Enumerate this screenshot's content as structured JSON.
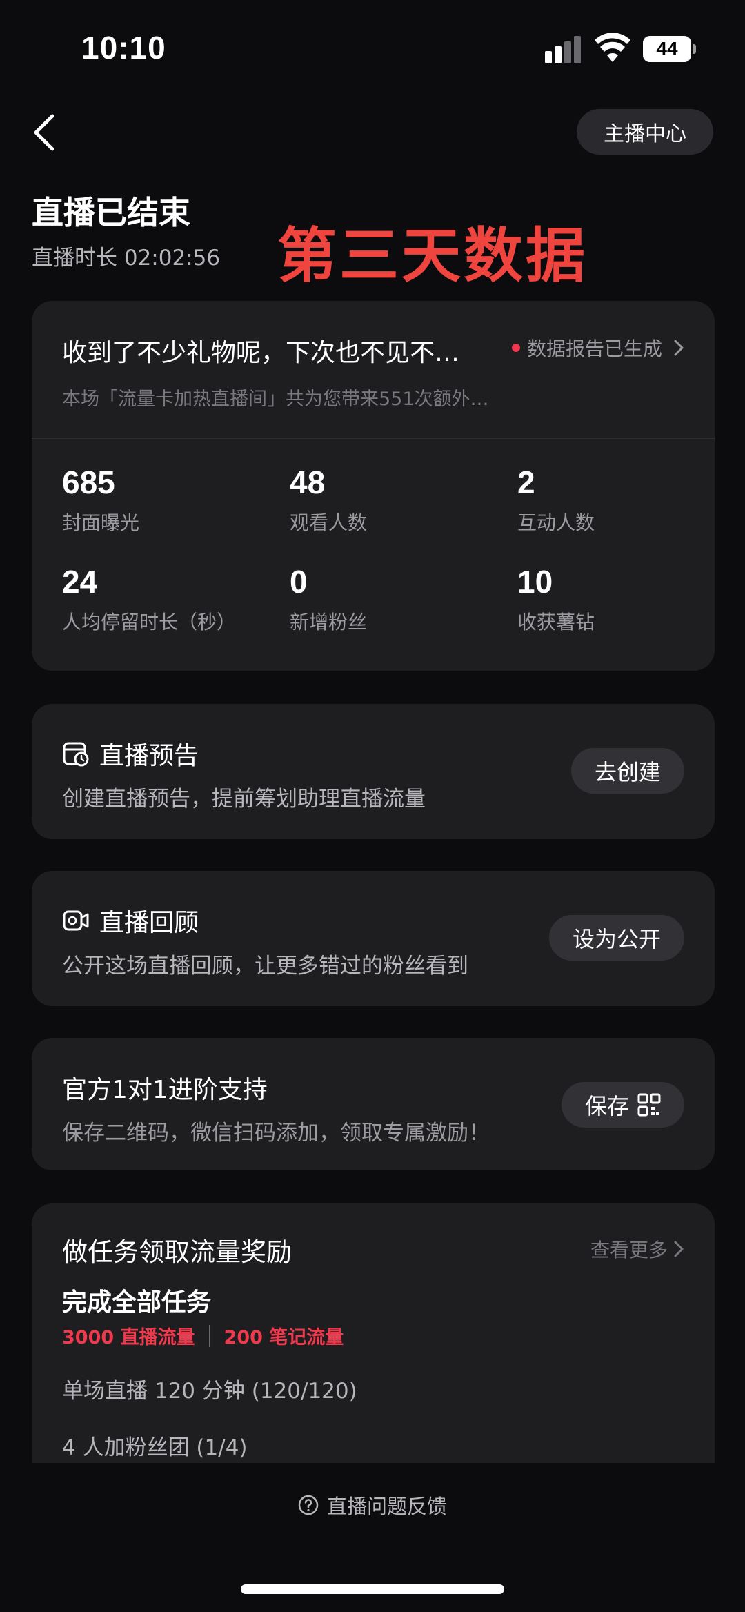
{
  "status_bar": {
    "time": "10:10",
    "battery": "44",
    "icons": [
      "cellular-signal-icon",
      "wifi-icon",
      "battery-icon"
    ]
  },
  "nav": {
    "back_icon": "chevron-left-icon",
    "anchor_center_label": "主播中心"
  },
  "header": {
    "title": "直播已结束",
    "duration": "直播时长 02:02:56",
    "overlay_text": "第三天数据"
  },
  "stats_card": {
    "headline": "收到了不少礼物呢，下次也不见不…",
    "report_label": "数据报告已生成",
    "subtext": "本场「流量卡加热直播间」共为您带来551次额外…",
    "metrics": [
      {
        "value": "685",
        "label": "封面曝光"
      },
      {
        "value": "48",
        "label": "观看人数"
      },
      {
        "value": "2",
        "label": "互动人数"
      },
      {
        "value": "24",
        "label": "人均停留时长（秒）"
      },
      {
        "value": "0",
        "label": "新增粉丝"
      },
      {
        "value": "10",
        "label": "收获薯钻"
      }
    ]
  },
  "preview_card": {
    "title": "直播预告",
    "description": "创建直播预告，提前筹划助理直播流量",
    "button": "去创建",
    "icon": "calendar-clock-icon"
  },
  "replay_card": {
    "title": "直播回顾",
    "description": "公开这场直播回顾，让更多错过的粉丝看到",
    "button": "设为公开",
    "icon": "video-replay-icon"
  },
  "support_card": {
    "title": "官方1对1进阶支持",
    "description": "保存二维码，微信扫码添加，领取专属激励！",
    "button": "保存",
    "icon": "qr-code-icon"
  },
  "tasks_card": {
    "title": "做任务领取流量奖励",
    "more_label": "查看更多",
    "all_tasks": "完成全部任务",
    "reward_live": "3000 直播流量",
    "reward_note": "200 笔记流量",
    "items": [
      "单场直播 120 分钟 (120/120)",
      "4 人加粉丝团 (1/4)"
    ]
  },
  "feedback": {
    "label": "直播问题反馈",
    "icon": "question-circle-icon"
  },
  "colors": {
    "background": "#0c0c0e",
    "card": "#1e1e21",
    "accent_red": "#f0443e",
    "reward_red": "#ee3a4c"
  }
}
